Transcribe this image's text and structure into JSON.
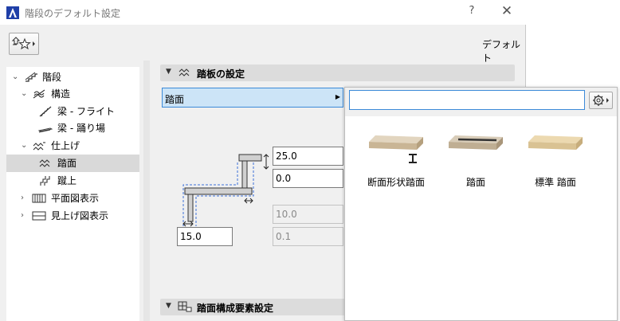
{
  "window": {
    "title": "階段のデフォルト設定",
    "help_label": "?",
    "close_label": "✕",
    "icon": "archicad-logo-icon"
  },
  "toolbar": {
    "favorites_icon": "favorites-star-icon",
    "default_label": "デフォルト"
  },
  "tree": {
    "items": [
      {
        "label": "階段",
        "icon": "stair-icon",
        "expanded": true
      },
      {
        "label": "構造",
        "icon": "structure-icon",
        "expanded": true
      },
      {
        "label": "梁 - フライト",
        "icon": "beam-flight-icon"
      },
      {
        "label": "梁 - 踊り場",
        "icon": "beam-landing-icon"
      },
      {
        "label": "仕上げ",
        "icon": "finish-icon",
        "expanded": true
      },
      {
        "label": "踏面",
        "icon": "tread-icon",
        "selected": true
      },
      {
        "label": "蹴上",
        "icon": "riser-icon"
      },
      {
        "label": "平面図表示",
        "icon": "floorplan-icon",
        "expanded": false
      },
      {
        "label": "見上げ図表示",
        "icon": "ceiling-plan-icon",
        "expanded": false
      }
    ]
  },
  "tread_section": {
    "title": "踏板の設定",
    "selector_label": "踏面",
    "fields": {
      "thickness": "25.0",
      "offset": "0.0",
      "nosing": "15.0",
      "disabled_1": "10.0",
      "disabled_2": "0.1"
    }
  },
  "bottom_section": {
    "title": "踏面構成要素設定"
  },
  "popup": {
    "search_value": "",
    "profiles": [
      {
        "label": "断面形状踏面",
        "icon": "profiled-tread-icon"
      },
      {
        "label": "踏面",
        "icon": "tread-nosing-strip-icon"
      },
      {
        "label": "標準 踏面",
        "icon": "standard-tread-icon"
      }
    ]
  },
  "colors": {
    "selection": "#cce4f7",
    "focus_border": "#3c8ad8",
    "section_header": "#dcdcdc",
    "wood": "#dcc8a4"
  }
}
